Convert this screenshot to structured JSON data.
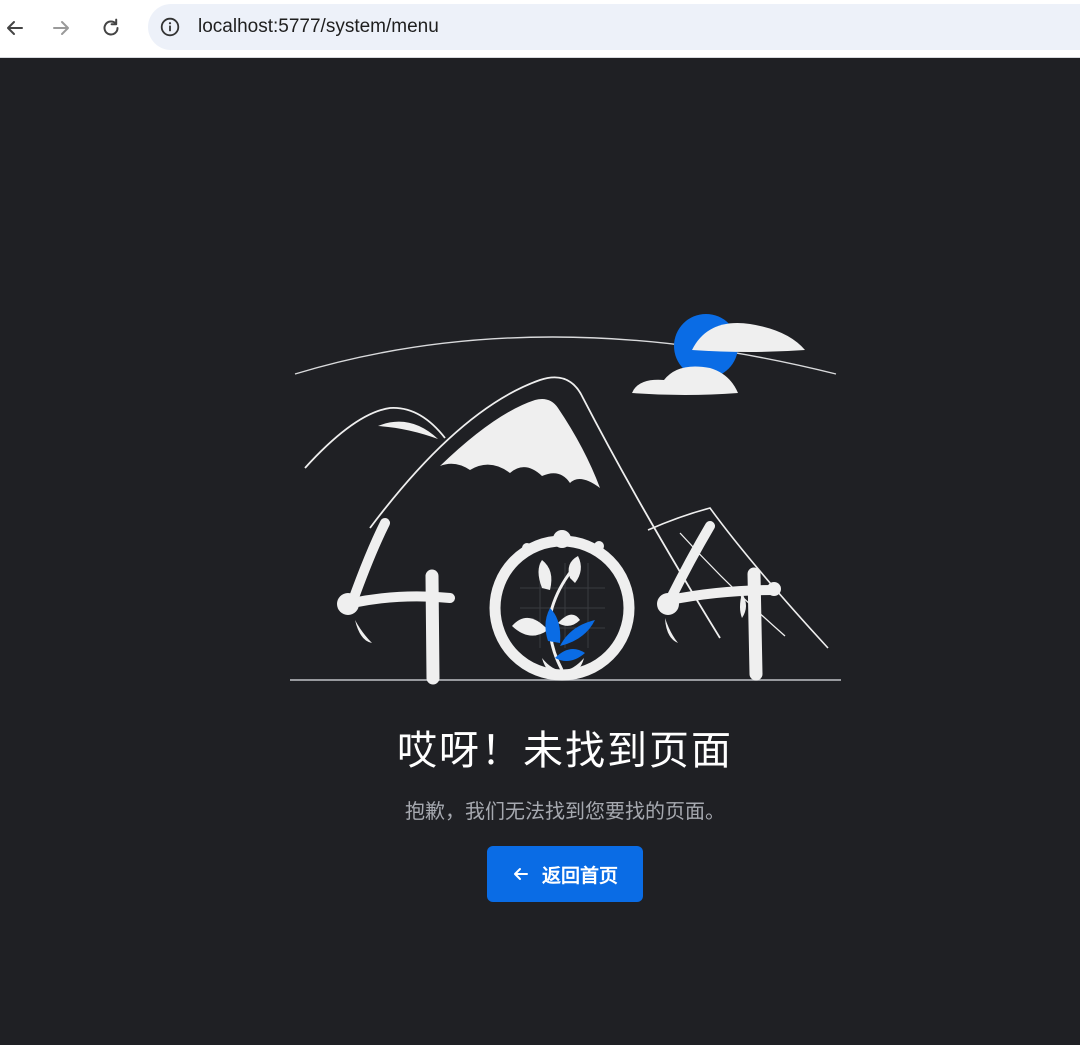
{
  "browser": {
    "back_icon": "arrow-left-icon",
    "forward_icon": "arrow-right-icon",
    "reload_icon": "reload-icon",
    "site_info_icon": "info-circle-icon",
    "url": "localhost:5777/system/menu"
  },
  "page": {
    "illustration": "404-illustration",
    "title": "哎呀！未找到页面",
    "description": "抱歉，我们无法找到您要找的页面。",
    "home_button": {
      "icon": "arrow-left-icon",
      "label": "返回首页"
    }
  },
  "colors": {
    "background": "#1f2024",
    "accent": "#0a6ce5",
    "illustration_fill": "#efefef",
    "muted_text": "#a6a9b0"
  }
}
